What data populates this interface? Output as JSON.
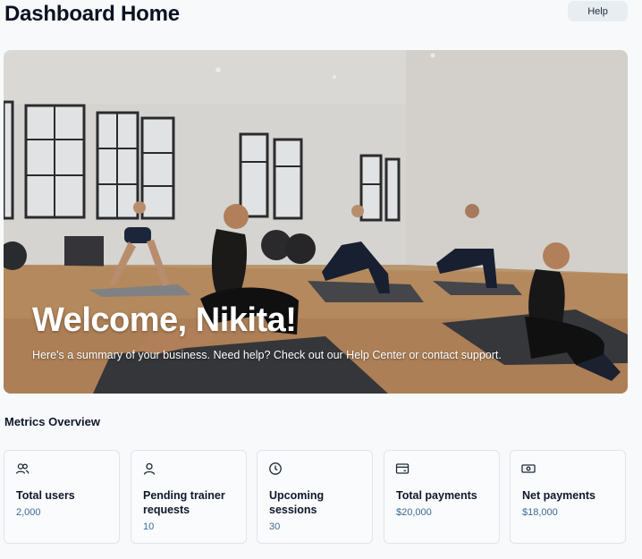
{
  "header": {
    "title": "Dashboard Home",
    "help_label": "Help"
  },
  "hero": {
    "title": "Welcome, Nikita!",
    "subtitle": "Here's a summary of your business. Need help? Check out our Help Center or contact support.",
    "image": "yoga-class-photo"
  },
  "metrics": {
    "section_title": "Metrics Overview",
    "items": [
      {
        "icon": "users-icon",
        "label": "Total users",
        "value": "2,000"
      },
      {
        "icon": "user-icon",
        "label": "Pending trainer requests",
        "value": "10"
      },
      {
        "icon": "clock-icon",
        "label": "Upcoming sessions",
        "value": "30"
      },
      {
        "icon": "credit-card-icon",
        "label": "Total payments",
        "value": "$20,000"
      },
      {
        "icon": "banknote-icon",
        "label": "Net payments",
        "value": "$18,000"
      }
    ]
  },
  "colors": {
    "accent_text": "#3b6a93",
    "card_border": "#dfe5ec",
    "help_bg": "#e8edf2"
  }
}
